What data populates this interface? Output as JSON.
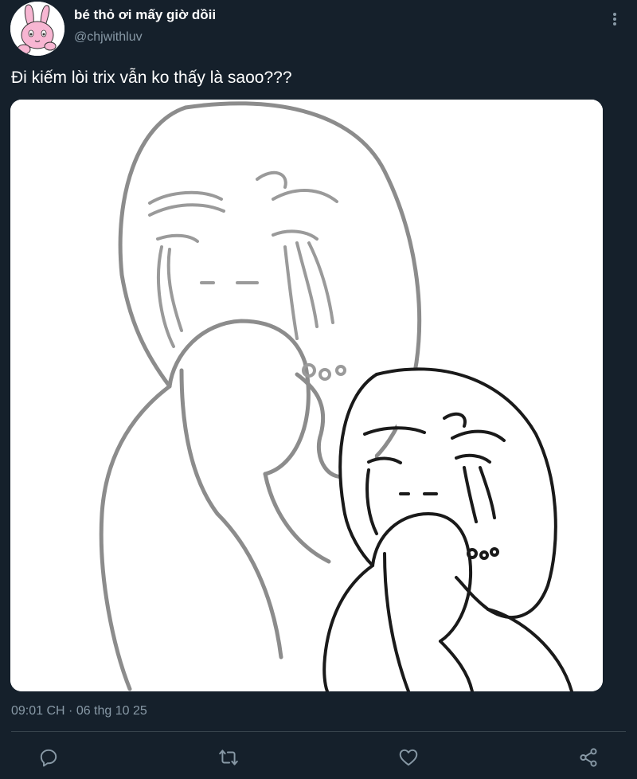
{
  "tweet": {
    "display_name": "bé thỏ ơi mấy giờ dồii",
    "handle": "@chjwithluv",
    "text": "Đi kiếm lòi trix vẫn ko thấy là saoo???",
    "timestamp": "09:01 CH · 06 thg 10 25"
  },
  "icons": {
    "more": "more-vertical-icon",
    "reply": "reply-icon",
    "retweet": "retweet-icon",
    "like": "heart-icon",
    "share": "share-icon"
  },
  "colors": {
    "background": "#15202b",
    "secondary_text": "#8899a6",
    "divider": "#38444d",
    "avatar_pink": "#f7b6d2"
  }
}
